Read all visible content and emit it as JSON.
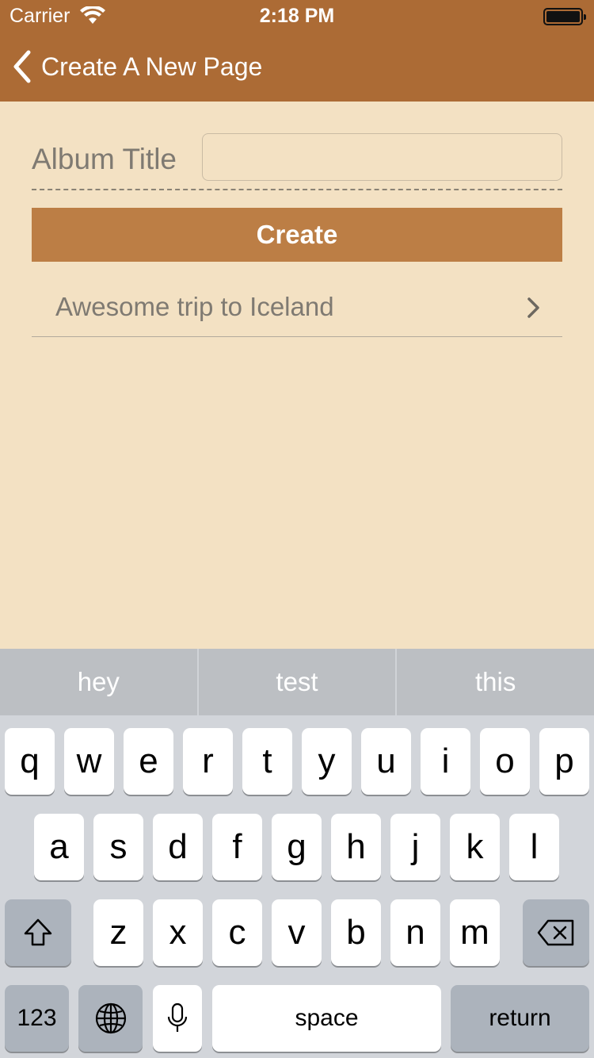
{
  "status_bar": {
    "carrier": "Carrier",
    "time": "2:18 PM"
  },
  "nav": {
    "back_label": "Create A New Page",
    "back_icon": "chevron-left-icon"
  },
  "form": {
    "album_title_label": "Album Title",
    "album_title_value": "",
    "album_title_placeholder": "",
    "create_label": "Create"
  },
  "list": {
    "items": [
      {
        "label": "Awesome trip to Iceland"
      }
    ]
  },
  "keyboard": {
    "suggestions": [
      "hey",
      "test",
      "this"
    ],
    "row1": [
      "q",
      "w",
      "e",
      "r",
      "t",
      "y",
      "u",
      "i",
      "o",
      "p"
    ],
    "row2": [
      "a",
      "s",
      "d",
      "f",
      "g",
      "h",
      "j",
      "k",
      "l"
    ],
    "row3": [
      "z",
      "x",
      "c",
      "v",
      "b",
      "n",
      "m"
    ],
    "numbers_label": "123",
    "space_label": "space",
    "return_label": "return"
  },
  "colors": {
    "nav_bar": "#ac6b35",
    "background": "#f3e1c3",
    "create_button": "#bc7e45"
  }
}
